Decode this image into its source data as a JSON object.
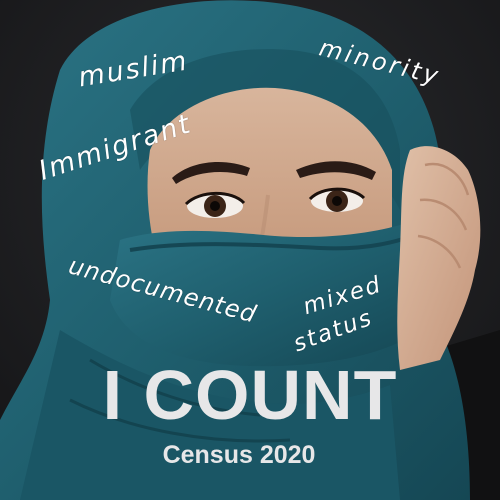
{
  "words": {
    "muslim": "muslim",
    "minority": "minority",
    "immigrant": "Immigrant",
    "undocumented": "undocumented",
    "mixed": "mixed",
    "status": "status"
  },
  "headline": "I COUNT",
  "subheadline": "Census 2020",
  "colors": {
    "background": "#1c1c1e",
    "scarf": "#1f5f6e",
    "text": "#e7e7e8"
  }
}
